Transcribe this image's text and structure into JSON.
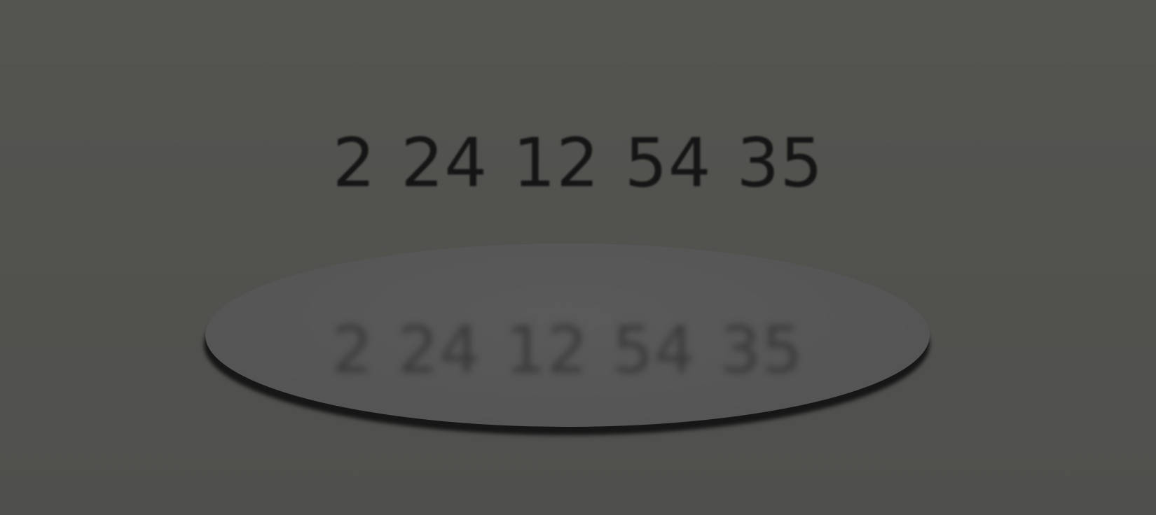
{
  "display": {
    "numbers": "2 24 12 54 35"
  },
  "disc": {
    "numbers": "2 24 12 54 35"
  },
  "colors": {
    "background": "#525250",
    "number_text": "#151515",
    "disc_fill": "#565656",
    "disc_shadow": "#161616",
    "disc_text": "#3a3a3a"
  }
}
